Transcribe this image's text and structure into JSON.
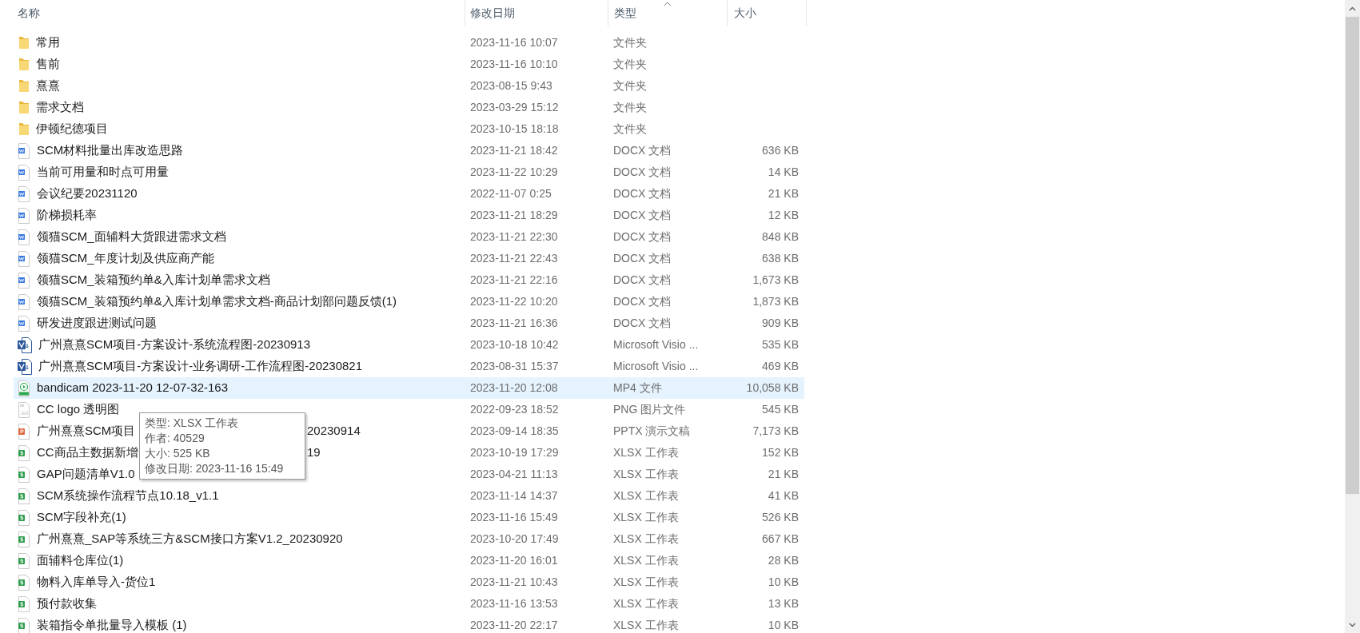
{
  "columns": [
    {
      "label": "名称",
      "sorted": false
    },
    {
      "label": "修改日期",
      "sorted": false
    },
    {
      "label": "类型",
      "sorted": true
    },
    {
      "label": "大小",
      "sorted": false
    }
  ],
  "rows": [
    {
      "kind": "folder",
      "name": "常用",
      "date": "2023-11-16 10:07",
      "type": "文件夹",
      "selected": false
    },
    {
      "kind": "folder",
      "name": "售前",
      "date": "2023-11-16 10:10",
      "type": "文件夹",
      "selected": false
    },
    {
      "kind": "folder",
      "name": "熹熹",
      "date": "2023-08-15 9:43",
      "type": "文件夹",
      "selected": false
    },
    {
      "kind": "folder",
      "name": "需求文档",
      "date": "2023-03-29 15:12",
      "type": "文件夹",
      "selected": false
    },
    {
      "kind": "folder",
      "name": "伊顿纪德项目",
      "date": "2023-10-15 18:18",
      "type": "文件夹",
      "selected": false
    },
    {
      "kind": "docx",
      "name": "SCM材料批量出库改造思路",
      "date": "2023-11-21 18:42",
      "type": "DOCX 文档",
      "size": "636 KB",
      "selected": false
    },
    {
      "kind": "docx",
      "name": "当前可用量和时点可用量",
      "date": "2023-11-22 10:29",
      "type": "DOCX 文档",
      "size": "14 KB",
      "selected": false
    },
    {
      "kind": "docx",
      "name": "会议纪要20231120",
      "date": "2022-11-07 0:25",
      "type": "DOCX 文档",
      "size": "21 KB",
      "selected": false
    },
    {
      "kind": "docx",
      "name": "阶梯损耗率",
      "date": "2023-11-21 18:29",
      "type": "DOCX 文档",
      "size": "12 KB",
      "selected": false
    },
    {
      "kind": "docx",
      "name": "领猫SCM_面辅料大货跟进需求文档",
      "date": "2023-11-21 22:30",
      "type": "DOCX 文档",
      "size": "848 KB",
      "selected": false
    },
    {
      "kind": "docx",
      "name": "领猫SCM_年度计划及供应商产能",
      "date": "2023-11-21 22:43",
      "type": "DOCX 文档",
      "size": "638 KB",
      "selected": false
    },
    {
      "kind": "docx",
      "name": "领猫SCM_装箱预约单&入库计划单需求文档",
      "date": "2023-11-21 22:16",
      "type": "DOCX 文档",
      "size": "1,673 KB",
      "selected": false
    },
    {
      "kind": "docx",
      "name": "领猫SCM_装箱预约单&入库计划单需求文档-商品计划部问题反馈(1)",
      "date": "2023-11-22 10:20",
      "type": "DOCX 文档",
      "size": "1,873 KB",
      "selected": false
    },
    {
      "kind": "docx",
      "name": "研发进度跟进测试问题",
      "date": "2023-11-21 16:36",
      "type": "DOCX 文档",
      "size": "909 KB",
      "selected": false
    },
    {
      "kind": "visio",
      "name": "广州熹熹SCM项目-方案设计-系统流程图-20230913",
      "date": "2023-10-18 10:42",
      "type": "Microsoft Visio ...",
      "size": "535 KB",
      "selected": false
    },
    {
      "kind": "visio",
      "name": "广州熹熹SCM项目-方案设计-业务调研-工作流程图-20230821",
      "date": "2023-08-31 15:37",
      "type": "Microsoft Visio ...",
      "size": "469 KB",
      "selected": false
    },
    {
      "kind": "mp4",
      "name": "bandicam 2023-11-20 12-07-32-163",
      "date": "2023-11-20 12:08",
      "type": "MP4 文件",
      "size": "10,058 KB",
      "selected": true
    },
    {
      "kind": "png",
      "name": "CC logo 透明图",
      "date": "2022-09-23 18:52",
      "type": "PNG 图片文件",
      "size": "545 KB",
      "selected": false
    },
    {
      "kind": "pptx",
      "name": "广州熹熹SCM项目",
      "name_tail": "20230914",
      "date": "2023-09-14 18:35",
      "type": "PPTX 演示文稿",
      "size": "7,173 KB",
      "selected": false
    },
    {
      "kind": "xlsx",
      "name": "CC商品主数据新增",
      "name_tail": "19",
      "date": "2023-10-19 17:29",
      "type": "XLSX 工作表",
      "size": "152 KB",
      "selected": false
    },
    {
      "kind": "xlsx",
      "name": "GAP问题清单V1.0",
      "date": "2023-04-21 11:13",
      "type": "XLSX 工作表",
      "size": "21 KB",
      "selected": false
    },
    {
      "kind": "xlsx",
      "name": "SCM系统操作流程节点10.18_v1.1",
      "date": "2023-11-14 14:37",
      "type": "XLSX 工作表",
      "size": "41 KB",
      "selected": false
    },
    {
      "kind": "xlsx",
      "name": "SCM字段补充(1)",
      "date": "2023-11-16 15:49",
      "type": "XLSX 工作表",
      "size": "526 KB",
      "selected": false
    },
    {
      "kind": "xlsx",
      "name": "广州熹熹_SAP等系统三方&SCM接口方案V1.2_20230920",
      "date": "2023-10-20 17:49",
      "type": "XLSX 工作表",
      "size": "667 KB",
      "selected": false
    },
    {
      "kind": "xlsx",
      "name": "面辅料仓库位(1)",
      "date": "2023-11-20 16:01",
      "type": "XLSX 工作表",
      "size": "28 KB",
      "selected": false
    },
    {
      "kind": "xlsx",
      "name": "物料入库单导入-货位1",
      "date": "2023-11-21 10:43",
      "type": "XLSX 工作表",
      "size": "10 KB",
      "selected": false
    },
    {
      "kind": "xlsx",
      "name": "预付款收集",
      "date": "2023-11-16 13:53",
      "type": "XLSX 工作表",
      "size": "13 KB",
      "selected": false
    },
    {
      "kind": "xlsx",
      "name": "装箱指令单批量导入模板 (1)",
      "date": "2023-11-20 22:17",
      "type": "XLSX 工作表",
      "size": "10 KB",
      "selected": false
    }
  ],
  "tooltip": {
    "lines": [
      "类型: XLSX 工作表",
      "作者: 40529",
      "大小: 525 KB",
      "修改日期: 2023-11-16 15:49"
    ]
  }
}
